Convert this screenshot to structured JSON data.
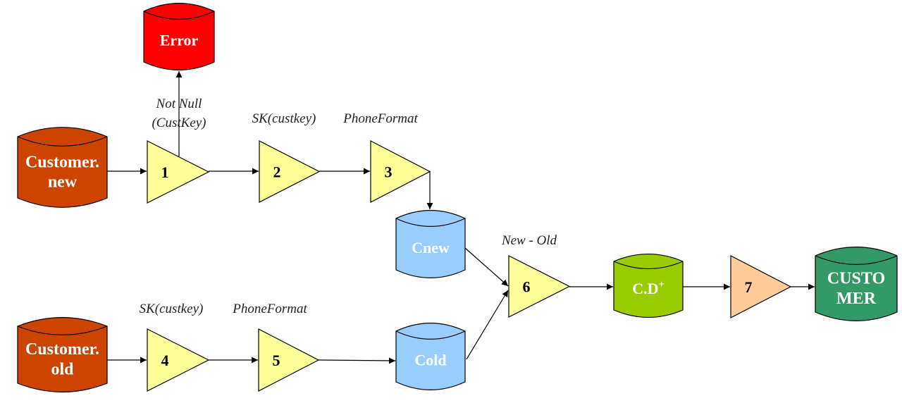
{
  "diagram": {
    "type": "etl-flow",
    "datastores": [
      {
        "id": "error",
        "lines": [
          "Error"
        ],
        "color": "#ff0000"
      },
      {
        "id": "customer-new",
        "lines": [
          "Customer.",
          "new"
        ],
        "color": "#cc4400"
      },
      {
        "id": "customer-old",
        "lines": [
          "Customer.",
          "old"
        ],
        "color": "#cc4400"
      },
      {
        "id": "cnew",
        "lines": [
          "Cnew"
        ],
        "color": "#99ccff"
      },
      {
        "id": "cold",
        "lines": [
          "Cold"
        ],
        "color": "#99ccff"
      },
      {
        "id": "cd-plus",
        "lines": [
          "C.D",
          "+"
        ],
        "color": "#99cc00"
      },
      {
        "id": "customer",
        "lines": [
          "CUSTO",
          "MER"
        ],
        "color": "#339966"
      }
    ],
    "activities": [
      {
        "id": "act-1",
        "number": "1",
        "color": "#ffff99"
      },
      {
        "id": "act-2",
        "number": "2",
        "color": "#ffff99"
      },
      {
        "id": "act-3",
        "number": "3",
        "color": "#ffff99"
      },
      {
        "id": "act-4",
        "number": "4",
        "color": "#ffff99"
      },
      {
        "id": "act-5",
        "number": "5",
        "color": "#ffff99"
      },
      {
        "id": "act-6",
        "number": "6",
        "color": "#ffff99"
      },
      {
        "id": "act-7",
        "number": "7",
        "color": "#ffcc99"
      }
    ],
    "annotations": [
      {
        "id": "notnull",
        "lines": [
          "Not Null",
          "(CustKey)"
        ],
        "target": "act-1"
      },
      {
        "id": "sk-top",
        "lines": [
          "SK(custkey)"
        ],
        "target": "act-2"
      },
      {
        "id": "phone-top",
        "lines": [
          "PhoneFormat"
        ],
        "target": "act-3"
      },
      {
        "id": "sk-bottom",
        "lines": [
          "SK(custkey)"
        ],
        "target": "act-4"
      },
      {
        "id": "phone-bottom",
        "lines": [
          "PhoneFormat"
        ],
        "target": "act-5"
      },
      {
        "id": "newold",
        "lines": [
          "New - Old"
        ],
        "target": "act-6"
      }
    ],
    "edges": [
      {
        "from": "customer-new",
        "to": "act-1"
      },
      {
        "from": "act-1",
        "to": "error"
      },
      {
        "from": "act-1",
        "to": "act-2"
      },
      {
        "from": "act-2",
        "to": "act-3"
      },
      {
        "from": "act-3",
        "to": "cnew"
      },
      {
        "from": "customer-old",
        "to": "act-4"
      },
      {
        "from": "act-4",
        "to": "act-5"
      },
      {
        "from": "act-5",
        "to": "cold"
      },
      {
        "from": "cnew",
        "to": "act-6"
      },
      {
        "from": "cold",
        "to": "act-6"
      },
      {
        "from": "act-6",
        "to": "cd-plus"
      },
      {
        "from": "cd-plus",
        "to": "act-7"
      },
      {
        "from": "act-7",
        "to": "customer"
      }
    ]
  }
}
